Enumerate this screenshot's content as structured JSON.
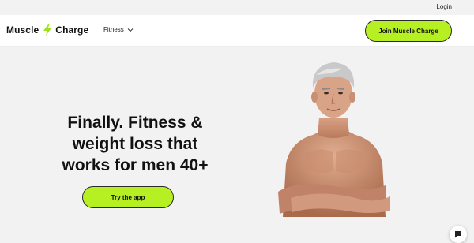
{
  "topbar": {
    "login_label": "Login"
  },
  "header": {
    "brand_left": "Muscle",
    "brand_right": "Charge",
    "nav_fitness": "Fitness",
    "join_label": "Join Muscle Charge"
  },
  "hero": {
    "headline_line1": "Finally. Fitness &",
    "headline_line2": "weight loss that",
    "headline_line3": "works for men 40+",
    "cta_label": "Try the app"
  },
  "icons": {
    "bolt": "lightning-bolt-icon",
    "chevron": "chevron-down-icon",
    "chat": "chat-icon"
  },
  "colors": {
    "accent": "#b6ef22",
    "background": "#f2f2f2",
    "header_bg": "#ffffff"
  }
}
